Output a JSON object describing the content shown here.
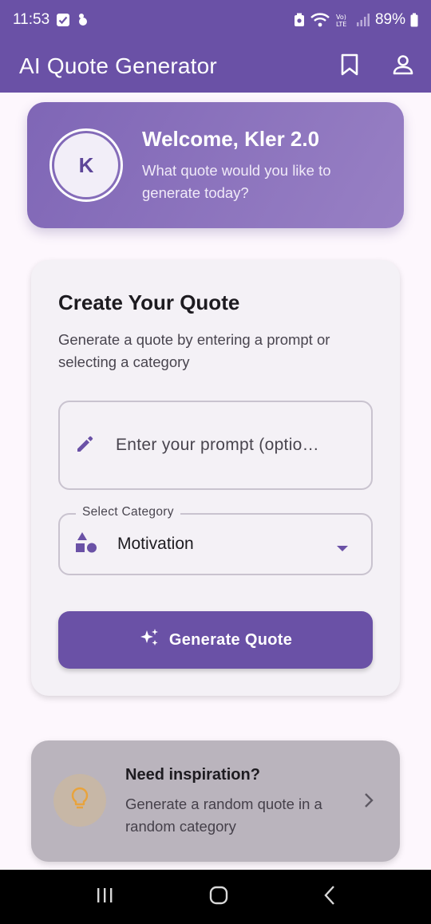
{
  "status_bar": {
    "time": "11:53",
    "battery": "89%"
  },
  "app_bar": {
    "title": "AI Quote Generator"
  },
  "welcome": {
    "avatar_initial": "K",
    "title": "Welcome, Kler 2.0",
    "subtitle": "What quote would you like to generate today?"
  },
  "create": {
    "title": "Create Your Quote",
    "description": "Generate a quote by entering a prompt or selecting a category",
    "prompt_placeholder": "Enter your prompt (optio…",
    "category_label": "Select Category",
    "category_value": "Motivation",
    "generate_label": "Generate Quote"
  },
  "inspiration": {
    "title": "Need inspiration?",
    "subtitle": "Generate a random quote in a random category"
  },
  "colors": {
    "primary": "#6a51a6",
    "background": "#fdf7fd",
    "card": "#f4f1f6",
    "bulb": "#e8a33c"
  },
  "icons": [
    "bookmark-icon",
    "account-icon",
    "edit-pencil-icon",
    "category-shapes-icon",
    "dropdown-arrow-icon",
    "sparkle-icon",
    "lightbulb-icon",
    "chevron-right-icon"
  ]
}
